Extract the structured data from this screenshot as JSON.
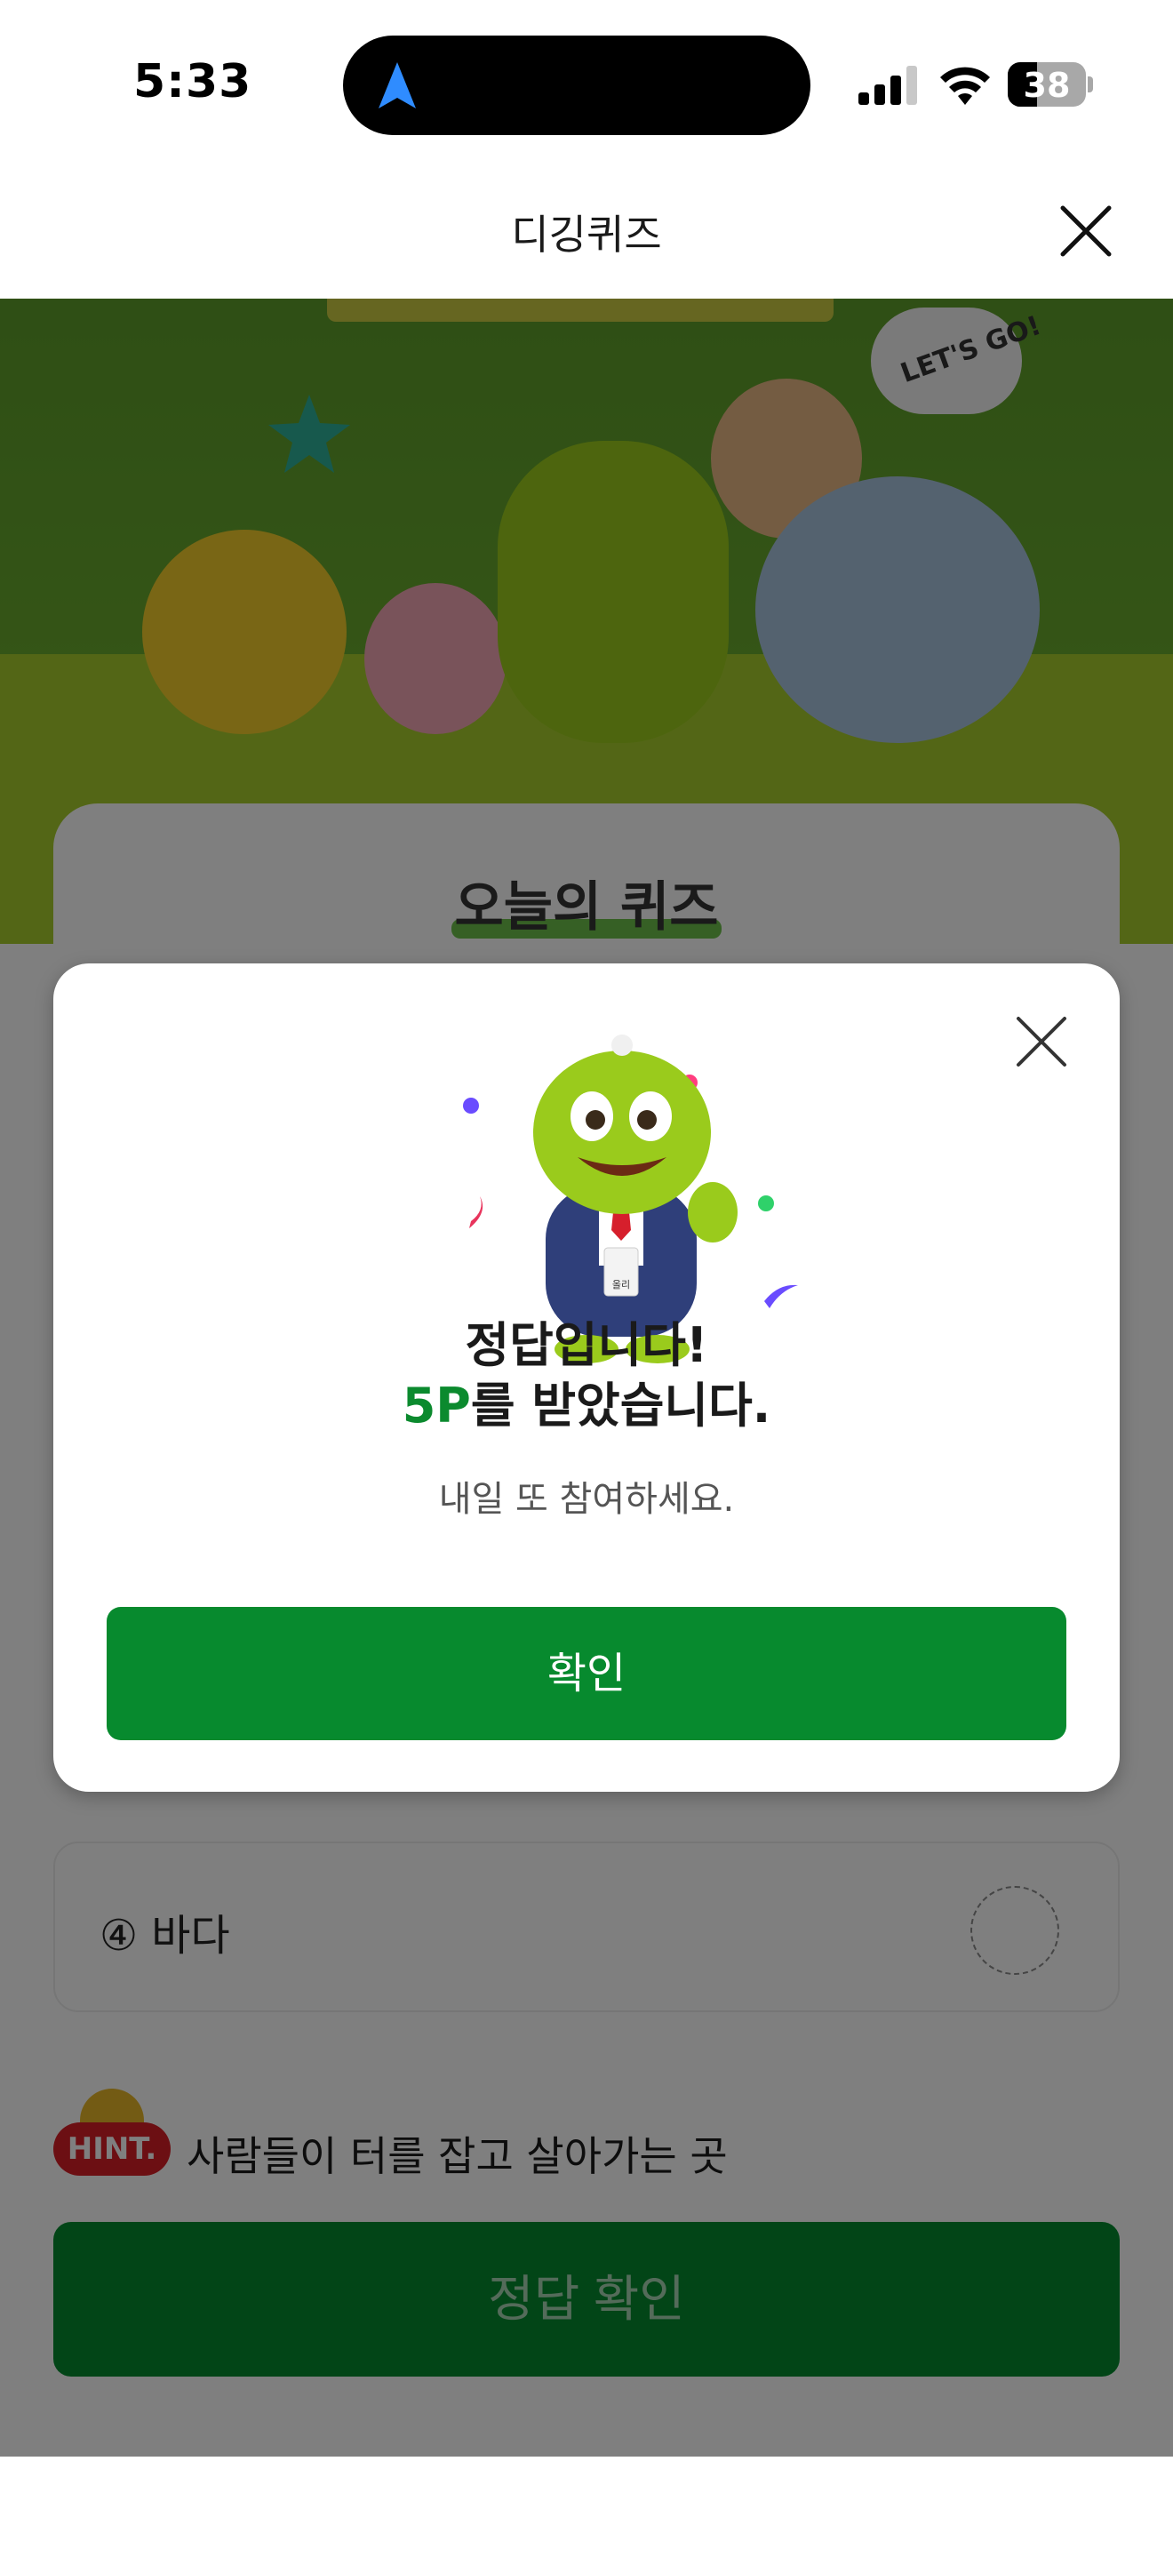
{
  "status_bar": {
    "time": "5:33",
    "battery_level": "38",
    "battery_fraction": 0.38
  },
  "header": {
    "title": "디깅퀴즈"
  },
  "banner": {
    "speech_bubble": "LET'S GO!"
  },
  "quiz_card": {
    "title": "오늘의 퀴즈"
  },
  "options": [
    {
      "label": "④ 바다"
    }
  ],
  "hint": {
    "badge": "HINT.",
    "text": "사람들이 터를 잡고 살아가는 곳"
  },
  "submit_button": {
    "label": "정답 확인"
  },
  "modal": {
    "title_line1": "정답입니다!",
    "points": "5P",
    "title_line2_suffix": "를 받았습니다.",
    "subtext": "내일 또 참여하세요.",
    "confirm_label": "확인",
    "mascot_badge": "올리"
  },
  "colors": {
    "primary_green": "#078a2e",
    "points_green": "#0b8a2e",
    "hint_red": "#d81f26"
  }
}
